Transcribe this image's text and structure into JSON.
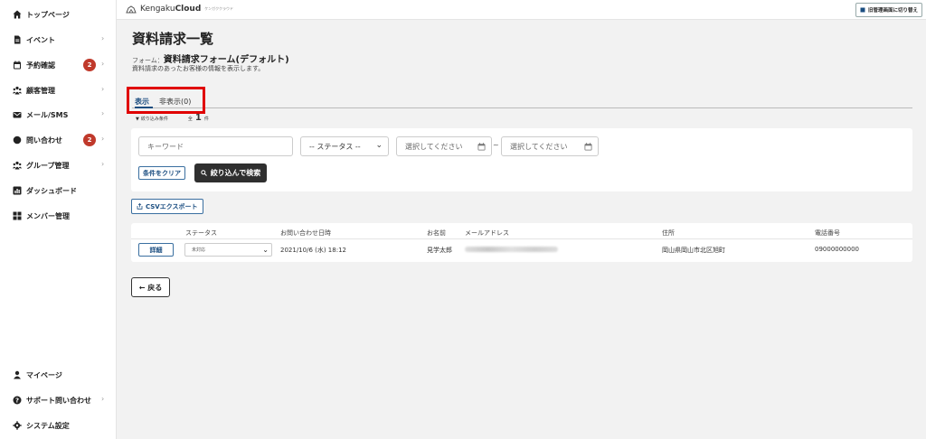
{
  "sidebar": {
    "items": [
      {
        "label": "トップページ",
        "icon": "home-icon"
      },
      {
        "label": "イベント",
        "icon": "document-icon",
        "chevron": "›"
      },
      {
        "label": "予約確認",
        "icon": "calendar-icon",
        "badge": "2",
        "chevron": "›"
      },
      {
        "label": "顧客管理",
        "icon": "people-icon",
        "chevron": "›"
      },
      {
        "label": "メール/SMS",
        "icon": "mail-icon",
        "chevron": "›"
      },
      {
        "label": "問い合わせ",
        "icon": "chat-icon",
        "badge": "2",
        "chevron": "›"
      },
      {
        "label": "グループ管理",
        "icon": "group-icon",
        "chevron": "›"
      },
      {
        "label": "ダッシュボード",
        "icon": "chart-icon"
      },
      {
        "label": "メンバー管理",
        "icon": "grid-icon"
      }
    ],
    "bottom_items": [
      {
        "label": "マイページ",
        "icon": "user-icon"
      },
      {
        "label": "サポート問い合わせ",
        "icon": "help-icon",
        "chevron": "›"
      },
      {
        "label": "システム設定",
        "icon": "gear-icon"
      }
    ]
  },
  "topbar": {
    "brand_prefix": "Kengaku",
    "brand_bold": "Cloud",
    "brand_sub": "ケンガククラウド",
    "switch_label": "旧管理画面に切り替え"
  },
  "main": {
    "title": "資料請求一覧",
    "form_prefix": "フォーム：",
    "form_name": "資料請求フォーム(デフォルト)",
    "description": "資料請求のあったお客様の情報を表示します。",
    "tabs": [
      {
        "label": "表示"
      },
      {
        "label": "非表示(0)"
      }
    ],
    "filter_caret": "▼",
    "filter_label": "絞り込み条件",
    "total_prefix": "全",
    "total_count": "1",
    "total_suffix": "件",
    "filters": {
      "keyword_placeholder": "キーワード",
      "status_placeholder": "-- ステータス --",
      "date_from_placeholder": "選択してください",
      "date_sep": "~",
      "date_to_placeholder": "選択してください",
      "clear_label": "条件をクリア",
      "search_label": "絞り込んで検索"
    },
    "csv_label": "CSVエクスポート",
    "table": {
      "headers": [
        "ステータス",
        "お問い合わせ日時",
        "お名前",
        "メールアドレス",
        "住所",
        "電話番号"
      ],
      "rows": [
        {
          "detail_label": "詳細",
          "status": "未対応",
          "datetime": "2021/10/6 (水) 18:12",
          "name": "見学太郎",
          "address": "岡山県岡山市北区旭町",
          "phone": "09000000000"
        }
      ]
    },
    "back_label": "← 戻る"
  }
}
